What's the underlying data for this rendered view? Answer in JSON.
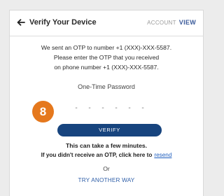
{
  "header": {
    "back_icon": "arrow-left-icon",
    "title": "Verify Your Device",
    "account_label": "ACCOUNT",
    "view_label": "VIEW"
  },
  "message": {
    "line1": "We sent an OTP to number +1 (XXX)-XXX-5587.",
    "line2": "Please enter the OTP that you received",
    "line3": "on phone number +1 (XXX)-XXX-5587."
  },
  "otp": {
    "label": "One-Time Password",
    "digits": [
      "-",
      "-",
      "-",
      "-",
      "-",
      "-"
    ]
  },
  "step_badge": "8",
  "verify_label": "VERIFY",
  "footer": {
    "take_minutes": "This can take a few minutes.",
    "no_otp_text": "If you didn't receive an OTP, click here to",
    "resend_label": "resend",
    "or_text": "Or",
    "another_way_label": "TRY ANOTHER WAY"
  },
  "colors": {
    "accent_orange": "#e5781d",
    "button_navy": "#17447e",
    "link_blue": "#1f5fbf"
  }
}
